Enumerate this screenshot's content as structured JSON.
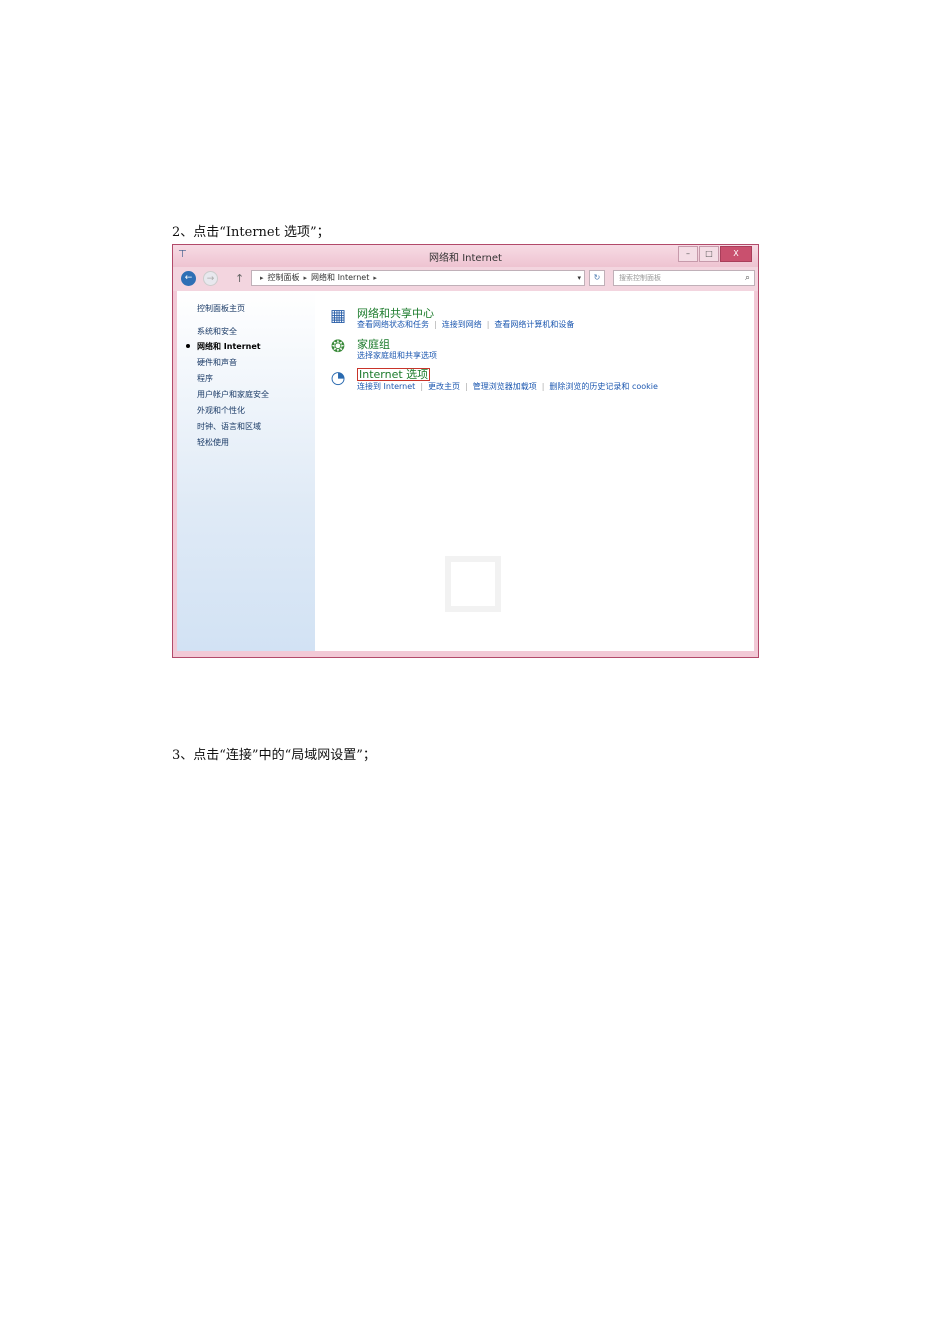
{
  "step2": "2、点击“Internet  选项”；",
  "step3": "3、点击“连接”中的“局域网设置”；",
  "window": {
    "title": "网络和 Internet",
    "minimize": "–",
    "maximize": "□",
    "close": "X",
    "address": {
      "crumb1": "控制面板",
      "crumb2": "网络和 Internet",
      "sep": "▸",
      "dropdown": "▾"
    },
    "search_placeholder": "搜索控制面板",
    "search_icon": "⌕",
    "refresh_icon": "↻",
    "back_icon": "←",
    "forward_icon": "→",
    "up_icon": "↑",
    "app_icon": "⊤"
  },
  "sidebar": {
    "items": [
      "控制面板主页",
      "系统和安全",
      "网络和 Internet",
      "硬件和声音",
      "程序",
      "用户帐户和家庭安全",
      "外观和个性化",
      "时钟、语言和区域",
      "轻松使用"
    ],
    "active_index": 2
  },
  "categories": [
    {
      "head": "网络和共享中心",
      "icon": "network-sharing-icon",
      "links": [
        "查看网络状态和任务",
        "连接到网络",
        "查看网络计算机和设备"
      ]
    },
    {
      "head": "家庭组",
      "icon": "homegroup-icon",
      "links": [
        "选择家庭组和共享选项"
      ]
    },
    {
      "head": "Internet 选项",
      "icon": "internet-options-icon",
      "links": [
        "连接到 Internet",
        "更改主页",
        "管理浏览器加载项",
        "删除浏览的历史记录和 cookie"
      ]
    }
  ],
  "colors": {
    "frame": "#f2c9d6",
    "highlight_box": "#c8342a",
    "category_green": "#1a7a2a",
    "link_blue": "#1d58b0"
  }
}
